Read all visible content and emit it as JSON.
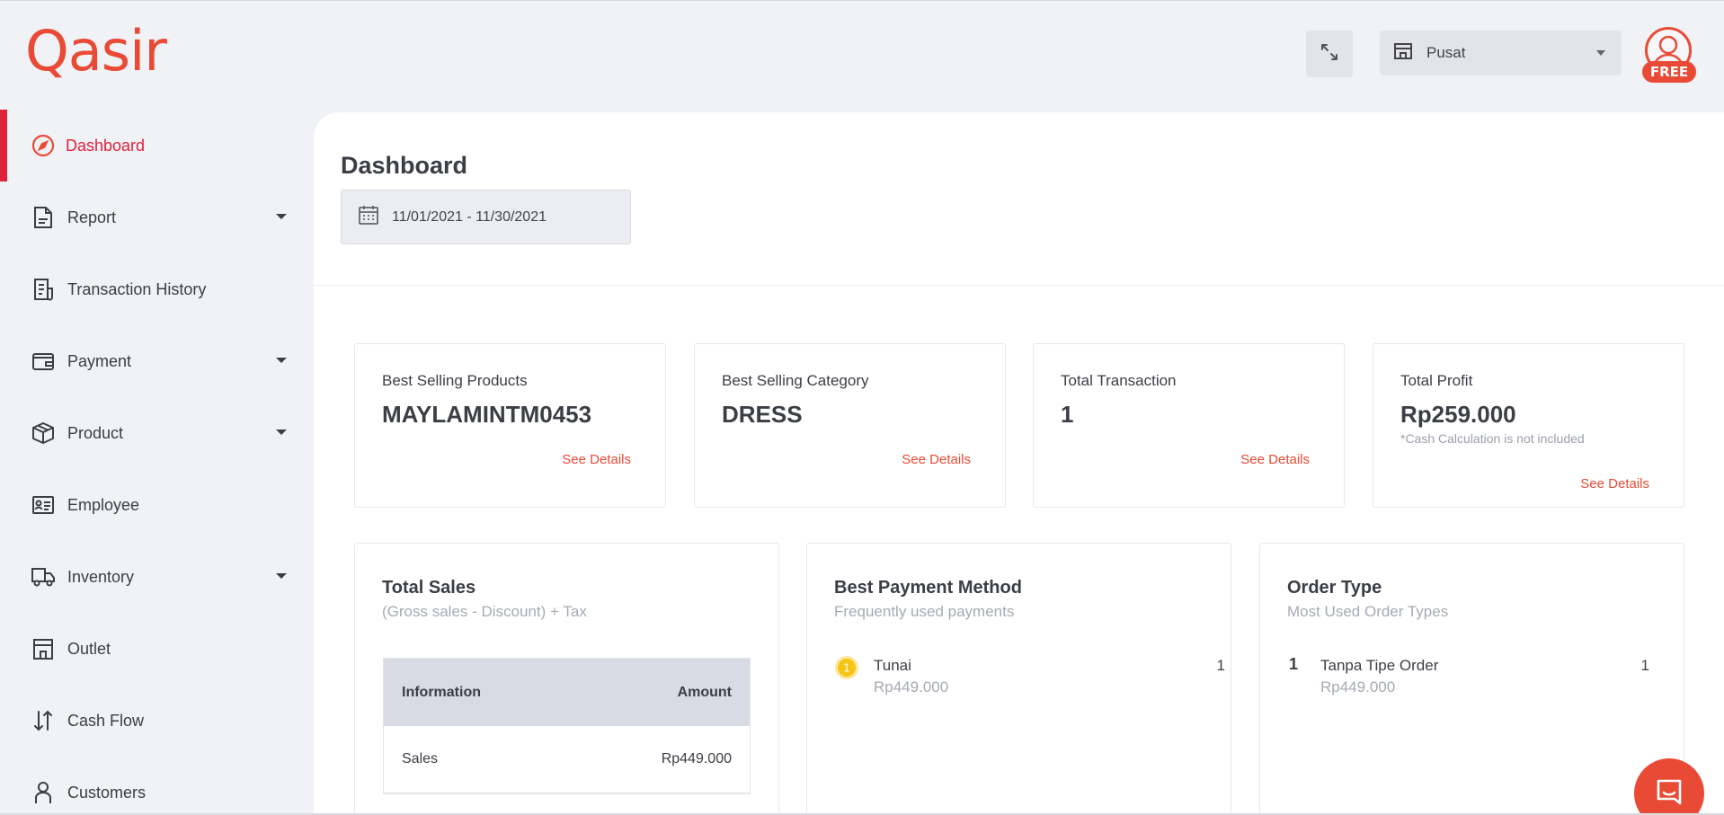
{
  "brand": {
    "logo_text": "Qasir",
    "accent": "#e94a35"
  },
  "header": {
    "outlet_label": "Pusat",
    "plan_badge": "FREE"
  },
  "sidebar": {
    "items": [
      {
        "label": "Dashboard",
        "icon": "compass-icon",
        "active": true
      },
      {
        "label": "Report",
        "icon": "document-icon",
        "has_submenu": true
      },
      {
        "label": "Transaction History",
        "icon": "receipt-icon"
      },
      {
        "label": "Payment",
        "icon": "wallet-icon",
        "has_submenu": true
      },
      {
        "label": "Product",
        "icon": "box-icon",
        "has_submenu": true
      },
      {
        "label": "Employee",
        "icon": "id-card-icon"
      },
      {
        "label": "Inventory",
        "icon": "truck-icon",
        "has_submenu": true
      },
      {
        "label": "Outlet",
        "icon": "store-icon"
      },
      {
        "label": "Cash Flow",
        "icon": "arrows-up-down-icon"
      },
      {
        "label": "Customers",
        "icon": "person-icon"
      }
    ]
  },
  "main": {
    "title": "Dashboard",
    "date_range": "11/01/2021 - 11/30/2021",
    "stats": [
      {
        "title": "Best Selling Products",
        "value": "MAYLAMINTM0453",
        "link": "See Details"
      },
      {
        "title": "Best Selling Category",
        "value": "DRESS",
        "link": "See Details"
      },
      {
        "title": "Total Transaction",
        "value": "1",
        "link": "See Details"
      },
      {
        "title": "Total Profit",
        "value": "Rp259.000",
        "note": "*Cash Calculation is not included",
        "link": "See Details"
      }
    ],
    "total_sales": {
      "title": "Total Sales",
      "subtitle": "(Gross sales - Discount) + Tax",
      "headers": [
        "Information",
        "Amount"
      ],
      "rows": [
        {
          "info": "Sales",
          "amount": "Rp449.000"
        }
      ]
    },
    "payment_method": {
      "title": "Best Payment Method",
      "subtitle": "Frequently used payments",
      "items": [
        {
          "rank": "1",
          "name": "Tunai",
          "amount": "Rp449.000",
          "count": "1"
        }
      ]
    },
    "order_type": {
      "title": "Order Type",
      "subtitle": "Most Used Order Types",
      "items": [
        {
          "rank": "1",
          "name": "Tanpa Tipe Order",
          "amount": "Rp449.000",
          "count": "1"
        }
      ]
    }
  }
}
